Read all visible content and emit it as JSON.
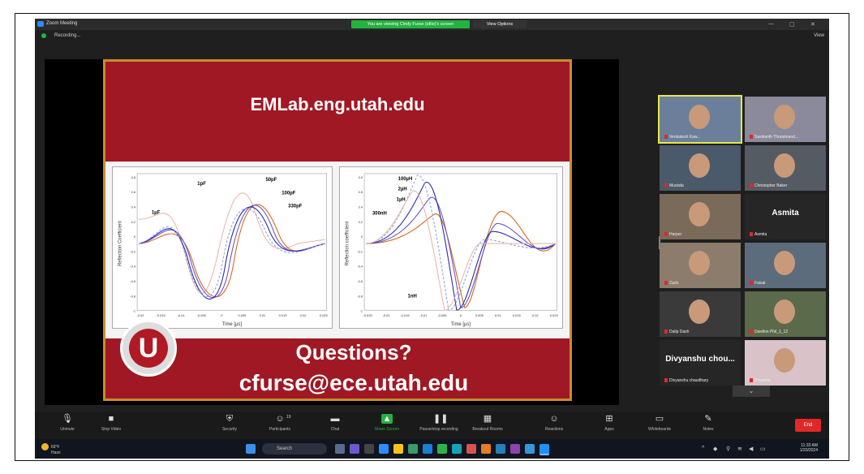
{
  "window": {
    "title": "Zoom Meeting",
    "share_banner": "You are viewing Cindy Furse (ellie)'s screen",
    "view_options": "View Options",
    "recording": "Recording...",
    "view_label": "View"
  },
  "slide": {
    "url": "EMLab.eng.utah.edu",
    "questions": "Questions?",
    "email": "cfurse@ece.utah.edu",
    "seal_letter": "U",
    "left_plot": {
      "ylabel": "Reflection Coefficient",
      "xlabel": "Time [µs]",
      "yticks": [
        "0.8",
        "0.6",
        "0.4",
        "0.2",
        "0",
        "-0.2",
        "-0.4",
        "-0.6",
        "-0.8",
        "-1"
      ],
      "xticks": [
        "-0.02",
        "-0.015",
        "-0.01",
        "-0.005",
        "0",
        "0.005",
        "0.01",
        "0.015",
        "0.02",
        "0.025"
      ],
      "labels": [
        "1pF",
        "50pF",
        "100pF",
        "330pF",
        "1µF"
      ]
    },
    "right_plot": {
      "ylabel": "Reflection coefficient",
      "xlabel": "Time [µs]",
      "yticks": [
        "0.8",
        "0.6",
        "0.4",
        "0.2",
        "0",
        "-0.2",
        "-0.4",
        "-0.6",
        "-0.8",
        "-1"
      ],
      "xticks": [
        "-0.025",
        "-0.02",
        "-0.015",
        "-0.01",
        "-0.005",
        "0",
        "0.005",
        "0.01",
        "0.015",
        "0.02",
        "0.025"
      ],
      "labels": [
        "100µH",
        "2µH",
        "1µH",
        "300nH",
        "1nH"
      ]
    }
  },
  "gallery": [
    {
      "name": "Venkatesh Kaw...",
      "kind": "video",
      "active": true
    },
    {
      "name": "Sasikanth Thuraimand...",
      "kind": "video"
    },
    {
      "name": "Mustafa",
      "kind": "video"
    },
    {
      "name": "Christopher Baker",
      "kind": "video"
    },
    {
      "name": "Harper",
      "kind": "video"
    },
    {
      "name": "Asmita",
      "kind": "name",
      "big": "Asmita"
    },
    {
      "name": "Zach",
      "kind": "video"
    },
    {
      "name": "Faisal",
      "kind": "video"
    },
    {
      "name": "Dalip Dash",
      "kind": "video"
    },
    {
      "name": "Dwelkin Phil_1_12",
      "kind": "video"
    },
    {
      "name": "Divyanshu chaudhary",
      "kind": "name",
      "big": "Divyanshu chou..."
    },
    {
      "name": "Priyanka",
      "kind": "video"
    }
  ],
  "toolbar": [
    {
      "label": "Unmute",
      "icon": "microphone-icon"
    },
    {
      "label": "Stop Video",
      "icon": "video-camera-icon"
    },
    {
      "label": "Security",
      "icon": "shield-icon"
    },
    {
      "label": "Participants",
      "icon": "participants-icon",
      "count": "19"
    },
    {
      "label": "Chat",
      "icon": "chat-icon"
    },
    {
      "label": "Share Screen",
      "icon": "share-screen-icon"
    },
    {
      "label": "Pause/stop recording",
      "icon": "pause-record-icon"
    },
    {
      "label": "Breakout Rooms",
      "icon": "breakout-icon"
    },
    {
      "label": "Reactions",
      "icon": "reactions-icon"
    },
    {
      "label": "Apps",
      "icon": "apps-icon"
    },
    {
      "label": "Whiteboards",
      "icon": "whiteboard-icon"
    },
    {
      "label": "Notes",
      "icon": "notes-icon"
    }
  ],
  "end_label": "End",
  "taskbar": {
    "weather_temp": "69°F",
    "weather_desc": "Haze",
    "search": "Search",
    "time": "11:33 AM",
    "date": "1/20/2024"
  }
}
